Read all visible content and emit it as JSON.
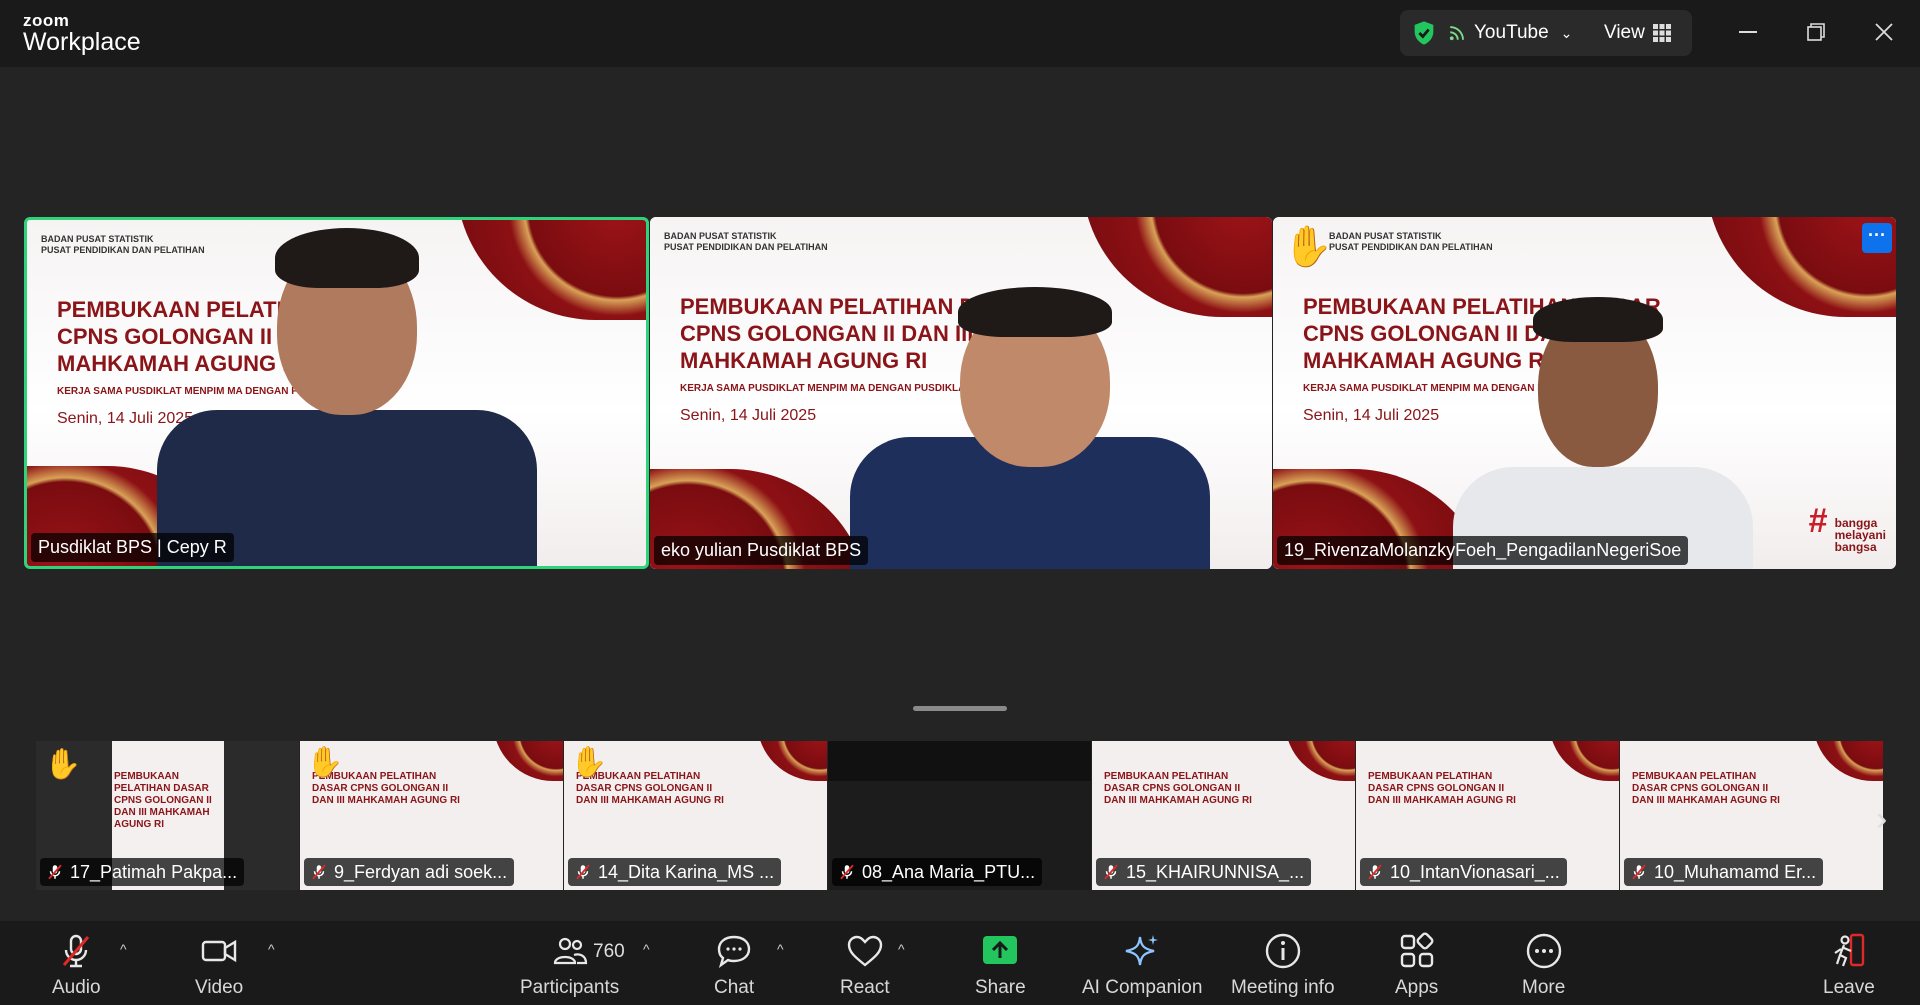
{
  "app": {
    "brand_top": "zoom",
    "brand_bottom": "Workplace"
  },
  "titlebar": {
    "stream_label": "YouTube",
    "view_label": "View"
  },
  "colors": {
    "accent_green": "#2fd37a",
    "zoom_blue": "#0e72ed",
    "share_green": "#22c55e",
    "mute_red": "#e02828",
    "slide_red": "#8a1418"
  },
  "slide": {
    "org_line1": "BADAN PUSAT STATISTIK",
    "org_line2": "PUSAT PENDIDIKAN DAN PELATIHAN",
    "title": "PEMBUKAAN PELATIHAN DASAR CPNS GOLONGAN II DAN III MAHKAMAH AGUNG RI",
    "subtitle": "KERJA SAMA PUSDIKLAT MENPIM MA DENGAN PUSDIKLAT",
    "date": "Senin, 14 Juli 2025",
    "tagline_1": "bangga",
    "tagline_2": "melayani",
    "tagline_3": "bangsa"
  },
  "speakers": [
    {
      "name": "Pusdiklat BPS | Cepy R"
    },
    {
      "name": "eko yulian Pusdiklat BPS"
    },
    {
      "name": "19_RivenzaMolanzkyFoeh_PengadilanNegeriSoe"
    }
  ],
  "gallery": [
    {
      "name": "17_Patimah Pakpa..."
    },
    {
      "name": "9_Ferdyan adi soek..."
    },
    {
      "name": "14_Dita Karina_MS ..."
    },
    {
      "name": "08_Ana Maria_PTU..."
    },
    {
      "name": "15_KHAIRUNNISA_..."
    },
    {
      "name": "10_IntanVionasari_..."
    },
    {
      "name": "10_Muhamamd Er..."
    }
  ],
  "toolbar": {
    "audio": "Audio",
    "video": "Video",
    "participants": "Participants",
    "participant_count": "760",
    "chat": "Chat",
    "react": "React",
    "share": "Share",
    "ai_companion": "AI Companion",
    "meeting_info": "Meeting info",
    "apps": "Apps",
    "more": "More",
    "leave": "Leave"
  }
}
